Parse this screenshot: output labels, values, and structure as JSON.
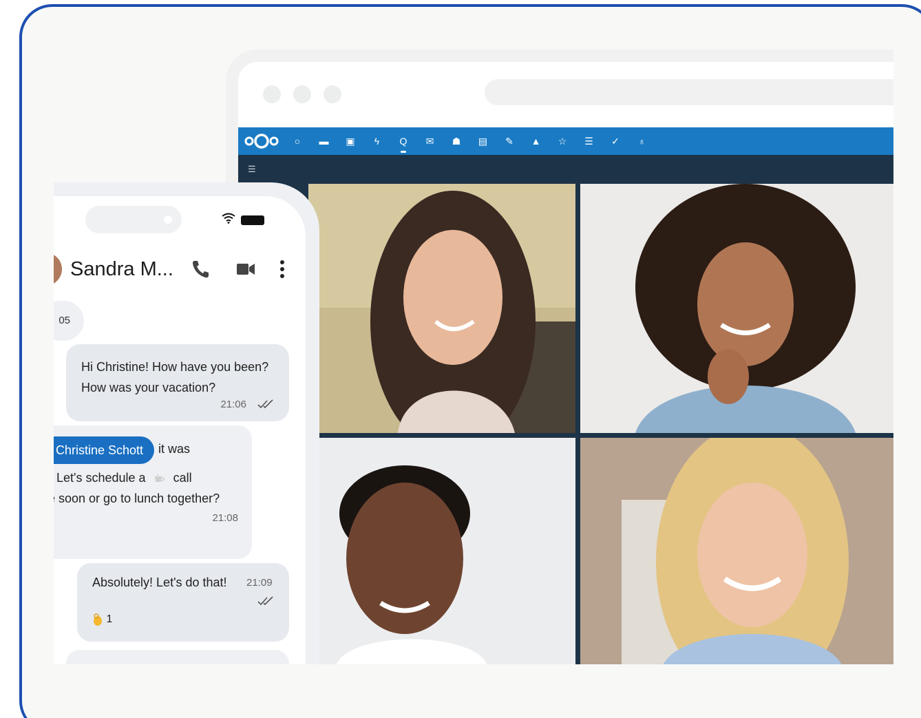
{
  "browser": {
    "toolbar_icons": [
      {
        "name": "dashboard-icon",
        "glyph": "○"
      },
      {
        "name": "files-icon",
        "glyph": "▬"
      },
      {
        "name": "photos-icon",
        "glyph": "▣"
      },
      {
        "name": "activity-icon",
        "glyph": "ϟ"
      },
      {
        "name": "talk-icon",
        "glyph": "Q",
        "active": true
      },
      {
        "name": "mail-icon",
        "glyph": "✉"
      },
      {
        "name": "contacts-icon",
        "glyph": "☗"
      },
      {
        "name": "calendar-icon",
        "glyph": "▤"
      },
      {
        "name": "notes-icon",
        "glyph": "✎"
      },
      {
        "name": "deck-icon",
        "glyph": "▲"
      },
      {
        "name": "favorites-icon",
        "glyph": "☆"
      },
      {
        "name": "tasks-list-icon",
        "glyph": "☰"
      },
      {
        "name": "tasks-icon",
        "glyph": "✓"
      },
      {
        "name": "maps-icon",
        "glyph": "♁"
      }
    ],
    "video_tiles": [
      {
        "name": "participant-1-video"
      },
      {
        "name": "participant-2-video"
      },
      {
        "name": "participant-3-video"
      },
      {
        "name": "participant-4-video"
      }
    ]
  },
  "phone": {
    "contact_name": "Sandra M...",
    "date_fragment": "05",
    "messages": [
      {
        "text": "Hi Christine! How have you been? How was your vacation?",
        "time": "21:06"
      },
      {
        "mention": "Christine Schott",
        "after": "it was",
        "line2_pre": "Let's schedule a",
        "line2_post": "call",
        "line3": "e soon or go to lunch together?",
        "time": "21:08"
      },
      {
        "text": "Absolutely! Let's do that!",
        "time": "21:09",
        "reaction_count": "1"
      }
    ]
  },
  "colors": {
    "frame_border": "#1c4fb0",
    "nextcloud_blue": "#1a7bc4",
    "call_dark": "#1d3347",
    "mention_blue": "#1a6fc2"
  }
}
